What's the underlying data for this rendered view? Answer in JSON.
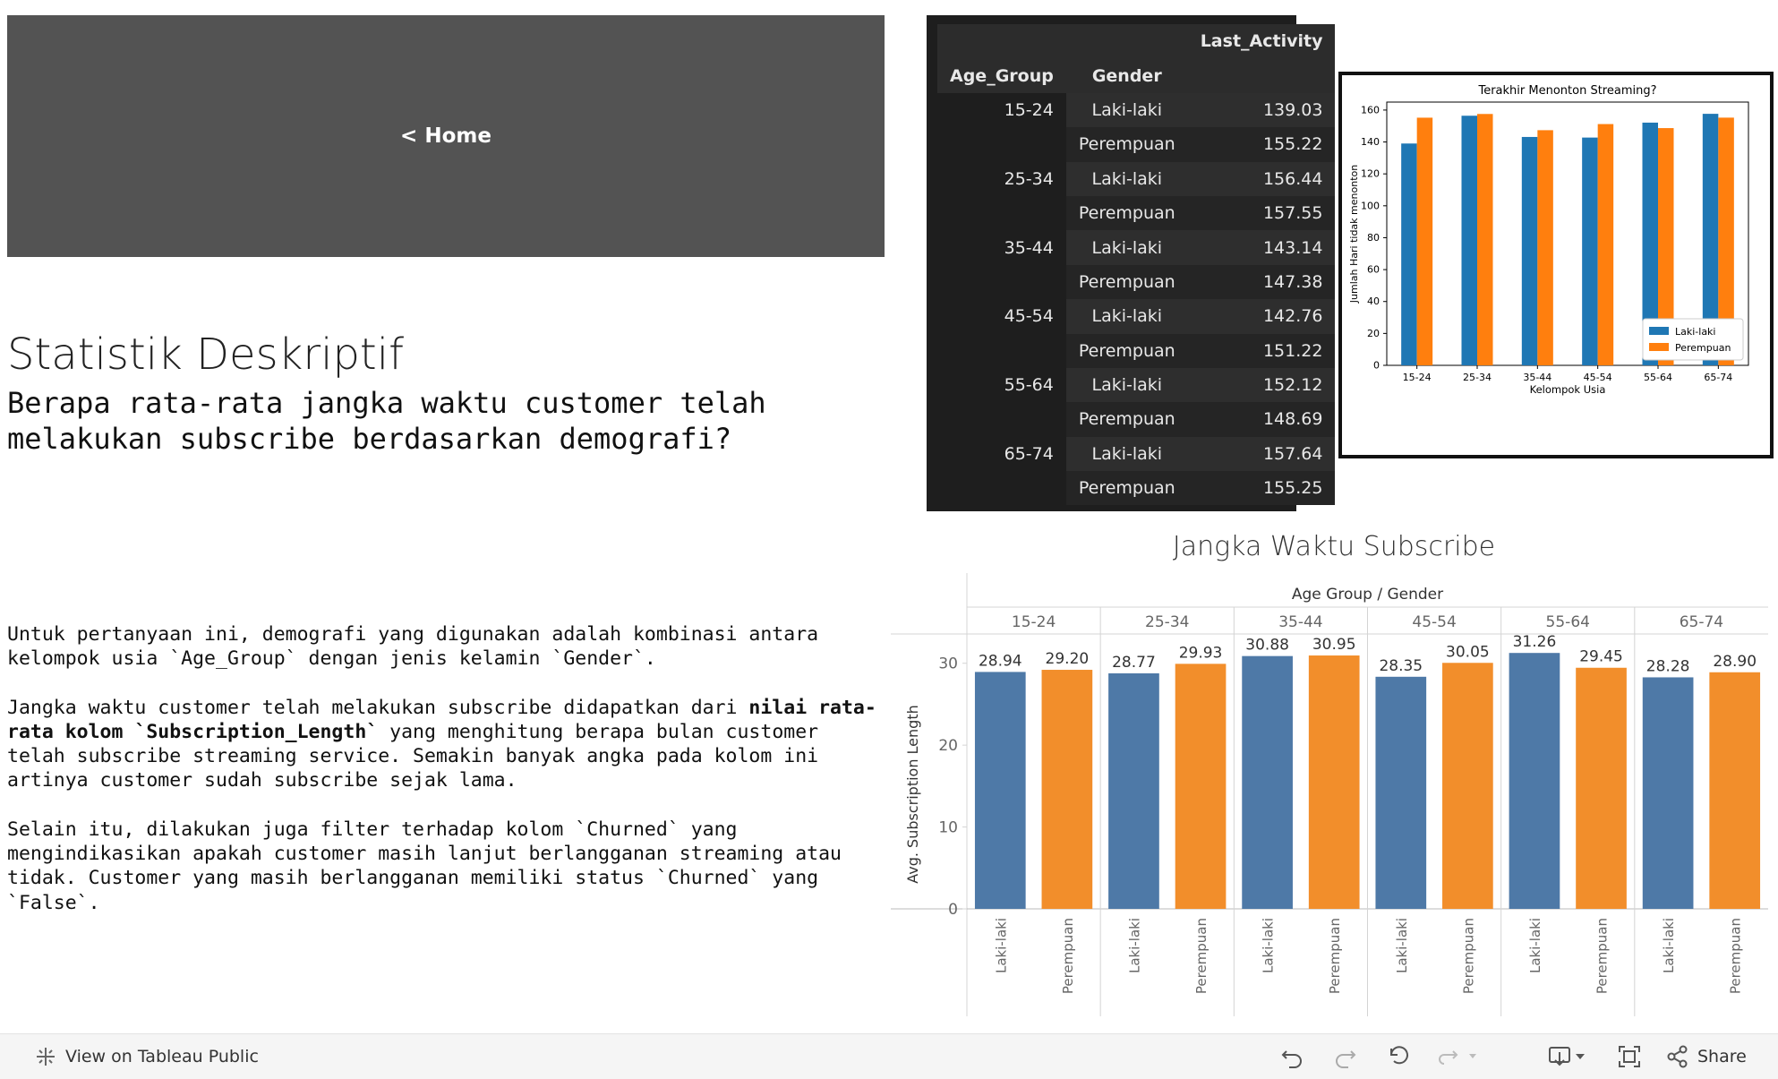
{
  "home": {
    "label": "< Home"
  },
  "text": {
    "title": "Statistik Deskriptif",
    "question_line1": "Berapa rata-rata jangka waktu customer telah",
    "question_line2": "melakukan subscribe berdasarkan demografi?",
    "para1": "Untuk pertanyaan ini, demografi yang digunakan adalah kombinasi antara kelompok usia `Age_Group` dengan jenis kelamin `Gender`.",
    "para2_a": "Jangka waktu customer telah melakukan subscribe didapatkan dari ",
    "para2_bold": "nilai rata-rata kolom `Subscription_Length`",
    "para2_b": " yang menghitung berapa bulan customer telah subscribe streaming service. Semakin banyak angka pada kolom ini artinya customer sudah subscribe sejak lama.",
    "para3": "Selain itu, dilakukan juga filter terhadap kolom `Churned` yang mengindikasikan apakah customer masih lanjut berlangganan streaming atau tidak. Customer yang masih berlangganan memiliki status `Churned` yang `False`."
  },
  "table": {
    "col_last_activity": "Last_Activity",
    "col_age_group": "Age_Group",
    "col_gender": "Gender",
    "rows": [
      {
        "age": "15-24",
        "gender": "Laki-laki",
        "value": "139.03"
      },
      {
        "age": "",
        "gender": "Perempuan",
        "value": "155.22"
      },
      {
        "age": "25-34",
        "gender": "Laki-laki",
        "value": "156.44"
      },
      {
        "age": "",
        "gender": "Perempuan",
        "value": "157.55"
      },
      {
        "age": "35-44",
        "gender": "Laki-laki",
        "value": "143.14"
      },
      {
        "age": "",
        "gender": "Perempuan",
        "value": "147.38"
      },
      {
        "age": "45-54",
        "gender": "Laki-laki",
        "value": "142.76"
      },
      {
        "age": "",
        "gender": "Perempuan",
        "value": "151.22"
      },
      {
        "age": "55-64",
        "gender": "Laki-laki",
        "value": "152.12"
      },
      {
        "age": "",
        "gender": "Perempuan",
        "value": "148.69"
      },
      {
        "age": "65-74",
        "gender": "Laki-laki",
        "value": "157.64"
      },
      {
        "age": "",
        "gender": "Perempuan",
        "value": "155.25"
      }
    ]
  },
  "chart_data": [
    {
      "type": "bar",
      "title": "Terakhir Menonton Streaming?",
      "xlabel": "Kelompok Usia",
      "ylabel": "Jumlah Hari tidak menonton",
      "categories": [
        "15-24",
        "25-34",
        "35-44",
        "45-54",
        "55-64",
        "65-74"
      ],
      "series": [
        {
          "name": "Laki-laki",
          "values": [
            139.03,
            156.44,
            143.14,
            142.76,
            152.12,
            157.64
          ],
          "color": "#1f77b4"
        },
        {
          "name": "Perempuan",
          "values": [
            155.22,
            157.55,
            147.38,
            151.22,
            148.69,
            155.25
          ],
          "color": "#ff7f0e"
        }
      ],
      "ylim": [
        0,
        165
      ],
      "yticks": [
        0,
        20,
        40,
        60,
        80,
        100,
        120,
        140,
        160
      ],
      "legend": "bottom-right",
      "grid": false
    },
    {
      "type": "bar",
      "title": "Jangka Waktu Subscribe",
      "header": "Age Group / Gender",
      "ylabel": "Avg. Subscription Length",
      "categories": [
        "15-24",
        "25-34",
        "35-44",
        "45-54",
        "55-64",
        "65-74"
      ],
      "subcategories": [
        "Laki-laki",
        "Perempuan"
      ],
      "series": [
        {
          "name": "Laki-laki",
          "values": [
            28.94,
            28.77,
            30.88,
            28.35,
            31.26,
            28.28
          ],
          "labels": [
            "28.94",
            "28.77",
            "30.88",
            "28.35",
            "31.26",
            "28.28"
          ],
          "color": "#4e79a7"
        },
        {
          "name": "Perempuan",
          "values": [
            29.2,
            29.93,
            30.95,
            30.05,
            29.45,
            28.9
          ],
          "labels": [
            "29.20",
            "29.93",
            "30.95",
            "30.05",
            "29.45",
            "28.90"
          ],
          "color": "#f28e2b"
        }
      ],
      "ylim": [
        0,
        35
      ],
      "yticks": [
        0,
        10,
        20,
        30
      ],
      "grid": false
    }
  ],
  "toolbar": {
    "view_label": "View on Tableau Public",
    "share_label": "Share"
  }
}
